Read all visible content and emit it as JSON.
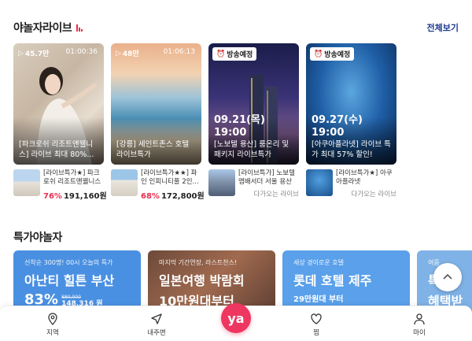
{
  "live": {
    "title": "야놀자라이브",
    "see_all": "전체보기",
    "cards": [
      {
        "views": "45.7만",
        "duration": "01:00:36",
        "caption": "[파크로쉬 리조트앤웰니스] 라이브 최대 80%...",
        "product_name": "[라이브특가★] 파크로쉬 리조트앤웰니스",
        "discount": "76%",
        "price": "191,160원"
      },
      {
        "views": "48만",
        "duration": "01:06:13",
        "caption": "[강릉] 세인트존스 호텔 라이브특가",
        "product_name": "[라이브특가★★] 파인 인피니티풀 2인...",
        "discount": "68%",
        "price": "172,800원"
      },
      {
        "badge": "방송예정",
        "date": "09.21(목)",
        "time": "19:00",
        "caption": "[노보텔 용산] 룸온리 및 패키지 라이브특가",
        "product_name": "[라이브특가] 노보텔 앰배서더 서울 용산",
        "upcoming": "다가오는 라이브"
      },
      {
        "badge": "방송예정",
        "date": "09.27(수)",
        "time": "19:00",
        "caption": "[아쿠아플라넷] 라이브 특가 최대 57% 할인!",
        "product_name": "[라이브특가★] 아쿠아플라넷",
        "upcoming": "다가오는 라이브"
      }
    ]
  },
  "deals": {
    "title": "특가야놀자",
    "cards": [
      {
        "sub": "선착순 300명! 00시 오늘의 특가",
        "name": "아난티 힐튼 부산",
        "percent": "83%",
        "orig_price": "880,000",
        "price": "148,316 원",
        "color": "#4a90e2"
      },
      {
        "sub": "마지막 기간연장, 라스트찬스!",
        "name": "일본여행 박람회",
        "line2": "10만원대부터",
        "color": "#8a5a44"
      },
      {
        "sub": "세상 경이로운 호텔",
        "name": "롯데 호텔 제주",
        "price": "29만원대 부터",
        "color": "#5aa0ea"
      },
      {
        "sub": "여름 ",
        "name": "특",
        "line2": "혜택받",
        "color": "#7fb2e6"
      }
    ]
  },
  "nav": {
    "tabs": [
      {
        "label": "지역",
        "icon": "map-pin-icon"
      },
      {
        "label": "내주변",
        "icon": "navigation-arrow-icon"
      },
      {
        "label": "찜",
        "icon": "heart-icon"
      },
      {
        "label": "마이",
        "icon": "person-icon"
      }
    ],
    "center_label": "ya"
  },
  "colors": {
    "brand": "#ee3760",
    "link": "#1b3a8f",
    "discount": "#e8304f"
  }
}
